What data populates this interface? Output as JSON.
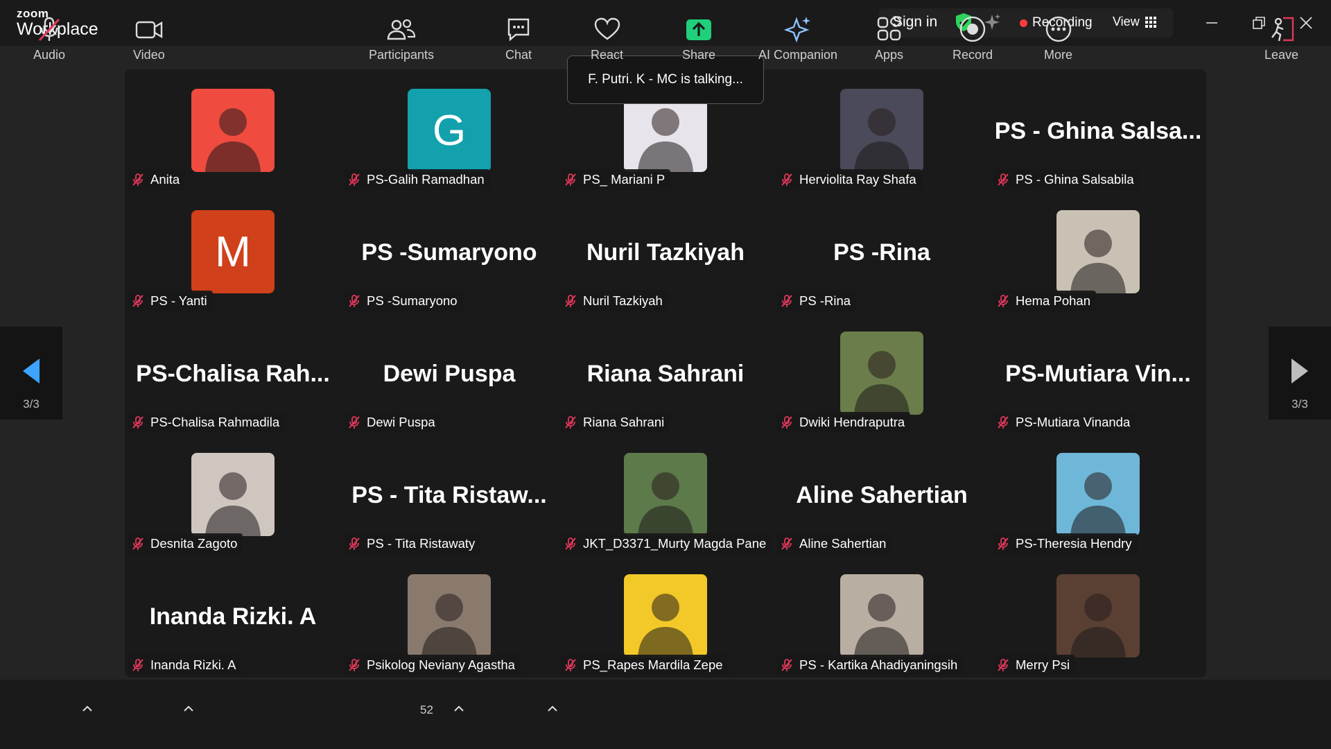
{
  "app": {
    "brand_top": "zoom",
    "brand_bottom": "Workplace"
  },
  "titlebar": {
    "sign_in": "Sign in",
    "recording": "Recording",
    "view": "View"
  },
  "toast": "F. Putri. K - MC is talking...",
  "pager": {
    "left": "3/3",
    "right": "3/3"
  },
  "colors": {
    "mute": "#e0375a",
    "share_green": "#1fcf7a",
    "accent_blue": "#3ea3ff"
  },
  "participants": [
    {
      "name": "Anita",
      "avatar": "photo",
      "color": "#ef4b3f"
    },
    {
      "name": "PS-Galih Ramadhan",
      "avatar": "letter",
      "letter": "G",
      "color": "#12a1ad"
    },
    {
      "name": "PS_ Mariani P",
      "avatar": "photo",
      "color": "#e8e4ec"
    },
    {
      "name": "Herviolita Ray Shafa",
      "avatar": "photo",
      "color": "#4a4a5a"
    },
    {
      "name": "PS - Ghina Salsabila",
      "avatar": "text",
      "display": "PS - Ghina Salsa..."
    },
    {
      "name": "PS - Yanti",
      "avatar": "letter",
      "letter": "M",
      "color": "#d0401a"
    },
    {
      "name": "PS -Sumaryono",
      "avatar": "text",
      "display": "PS -Sumaryono"
    },
    {
      "name": "Nuril Tazkiyah",
      "avatar": "text",
      "display": "Nuril Tazkiyah"
    },
    {
      "name": "PS -Rina",
      "avatar": "text",
      "display": "PS -Rina"
    },
    {
      "name": "Hema Pohan",
      "avatar": "photo",
      "color": "#c9c2b4"
    },
    {
      "name": "PS-Chalisa Rahmadila",
      "avatar": "text",
      "display": "PS-Chalisa  Rah..."
    },
    {
      "name": "Dewi Puspa",
      "avatar": "text",
      "display": "Dewi Puspa"
    },
    {
      "name": "Riana Sahrani",
      "avatar": "text",
      "display": "Riana Sahrani"
    },
    {
      "name": "Dwiki Hendraputra",
      "avatar": "photo",
      "color": "#6b7d4a"
    },
    {
      "name": "PS-Mutiara Vinanda",
      "avatar": "text",
      "display": "PS-Mutiara  Vin..."
    },
    {
      "name": "Desnita Zagoto",
      "avatar": "photo",
      "color": "#cfc6c0"
    },
    {
      "name": "PS - Tita Ristawaty",
      "avatar": "text",
      "display": "PS - Tita Ristaw..."
    },
    {
      "name": "JKT_D3371_Murty Magda Pane",
      "avatar": "photo",
      "color": "#5d7a4a"
    },
    {
      "name": "Aline Sahertian",
      "avatar": "text",
      "display": "Aline Sahertian"
    },
    {
      "name": "PS-Theresia Hendry",
      "avatar": "photo",
      "color": "#6fb7d8"
    },
    {
      "name": "Inanda Rizki. A",
      "avatar": "text",
      "display": "Inanda Rizki. A"
    },
    {
      "name": "Psikolog Neviany Agastha",
      "avatar": "photo",
      "color": "#8a7a6e"
    },
    {
      "name": "PS_Rapes Mardila Zepe",
      "avatar": "photo",
      "color": "#f2c928"
    },
    {
      "name": "PS - Kartika Ahadiyaningsih",
      "avatar": "photo",
      "color": "#b9aea2"
    },
    {
      "name": "Merry Psi",
      "avatar": "photo",
      "color": "#5a4033"
    }
  ],
  "toolbar": {
    "audio": "Audio",
    "video": "Video",
    "participants": "Participants",
    "participant_count": "52",
    "chat": "Chat",
    "react": "React",
    "share": "Share",
    "ai_companion": "AI Companion",
    "apps": "Apps",
    "record": "Record",
    "more": "More",
    "leave": "Leave"
  }
}
